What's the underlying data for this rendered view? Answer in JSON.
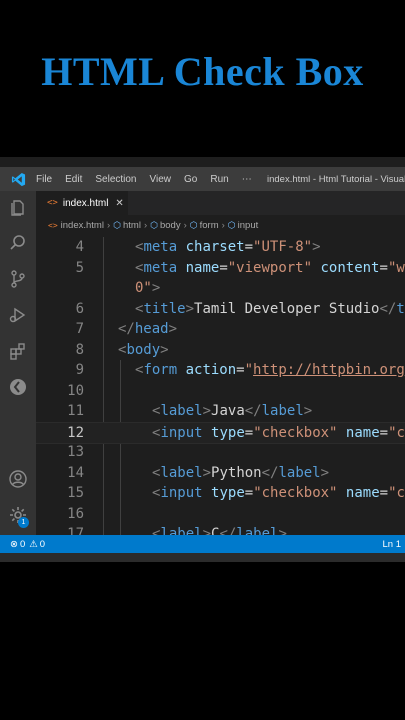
{
  "banner": {
    "title": "HTML Check Box"
  },
  "titlebar": {
    "menu": [
      "File",
      "Edit",
      "Selection",
      "View",
      "Go",
      "Run",
      "⋯"
    ],
    "window_title": "index.html - Html Tutorial - Visual"
  },
  "tab": {
    "label": "index.html",
    "close": "✕"
  },
  "breadcrumb": [
    "index.html",
    "html",
    "body",
    "form",
    "input"
  ],
  "editor": {
    "current_line": 12,
    "lines": [
      {
        "n": "4",
        "indent": 1,
        "tokens": [
          [
            "p",
            "<"
          ],
          [
            "t",
            "meta"
          ],
          [
            "w",
            " "
          ],
          [
            "a",
            "charset"
          ],
          [
            "w",
            "="
          ],
          [
            "s",
            "\"UTF-8\""
          ],
          [
            "p",
            ">"
          ]
        ]
      },
      {
        "n": "5",
        "indent": 1,
        "tokens": [
          [
            "p",
            "<"
          ],
          [
            "t",
            "meta"
          ],
          [
            "w",
            " "
          ],
          [
            "a",
            "name"
          ],
          [
            "w",
            "="
          ],
          [
            "s",
            "\"viewport\""
          ],
          [
            "w",
            " "
          ],
          [
            "a",
            "content"
          ],
          [
            "w",
            "="
          ],
          [
            "s",
            "\"wi"
          ]
        ]
      },
      {
        "n": "",
        "indent": 1,
        "tokens": [
          [
            "s",
            "0\""
          ],
          [
            "p",
            ">"
          ]
        ]
      },
      {
        "n": "6",
        "indent": 1,
        "tokens": [
          [
            "p",
            "<"
          ],
          [
            "t",
            "title"
          ],
          [
            "p",
            ">"
          ],
          [
            "w",
            "Tamil Developer Studio"
          ],
          [
            "p",
            "</"
          ],
          [
            "t",
            "ti"
          ]
        ]
      },
      {
        "n": "7",
        "indent": 0,
        "tokens": [
          [
            "p",
            "</"
          ],
          [
            "t",
            "head"
          ],
          [
            "p",
            ">"
          ]
        ]
      },
      {
        "n": "8",
        "indent": 0,
        "tokens": [
          [
            "p",
            "<"
          ],
          [
            "t",
            "body"
          ],
          [
            "p",
            ">"
          ]
        ]
      },
      {
        "n": "9",
        "indent": 1,
        "tokens": [
          [
            "p",
            "<"
          ],
          [
            "t",
            "form"
          ],
          [
            "w",
            " "
          ],
          [
            "a",
            "action"
          ],
          [
            "w",
            "="
          ],
          [
            "s",
            "\""
          ],
          [
            "u",
            "http://httpbin.org"
          ]
        ]
      },
      {
        "n": "10",
        "indent": 2,
        "tokens": []
      },
      {
        "n": "11",
        "indent": 2,
        "tokens": [
          [
            "p",
            "<"
          ],
          [
            "t",
            "label"
          ],
          [
            "p",
            ">"
          ],
          [
            "w",
            "Java"
          ],
          [
            "p",
            "</"
          ],
          [
            "t",
            "label"
          ],
          [
            "p",
            ">"
          ]
        ]
      },
      {
        "n": "12",
        "indent": 2,
        "tokens": [
          [
            "p",
            "<"
          ],
          [
            "t",
            "input"
          ],
          [
            "w",
            " "
          ],
          [
            "a",
            "type"
          ],
          [
            "w",
            "="
          ],
          [
            "s",
            "\"checkbox\""
          ],
          [
            "w",
            " "
          ],
          [
            "a",
            "name"
          ],
          [
            "w",
            "="
          ],
          [
            "s",
            "\"ch"
          ]
        ]
      },
      {
        "n": "13",
        "indent": 2,
        "tokens": []
      },
      {
        "n": "14",
        "indent": 2,
        "tokens": [
          [
            "p",
            "<"
          ],
          [
            "t",
            "label"
          ],
          [
            "p",
            ">"
          ],
          [
            "w",
            "Python"
          ],
          [
            "p",
            "</"
          ],
          [
            "t",
            "label"
          ],
          [
            "p",
            ">"
          ]
        ]
      },
      {
        "n": "15",
        "indent": 2,
        "tokens": [
          [
            "p",
            "<"
          ],
          [
            "t",
            "input"
          ],
          [
            "w",
            " "
          ],
          [
            "a",
            "type"
          ],
          [
            "w",
            "="
          ],
          [
            "s",
            "\"checkbox\""
          ],
          [
            "w",
            " "
          ],
          [
            "a",
            "name"
          ],
          [
            "w",
            "="
          ],
          [
            "s",
            "\"ch"
          ]
        ]
      },
      {
        "n": "16",
        "indent": 2,
        "tokens": []
      },
      {
        "n": "17",
        "indent": 2,
        "tokens": [
          [
            "p",
            "<"
          ],
          [
            "t",
            "label"
          ],
          [
            "p",
            ">"
          ],
          [
            "w",
            "C"
          ],
          [
            "p",
            "</"
          ],
          [
            "t",
            "label"
          ],
          [
            "p",
            ">"
          ]
        ]
      }
    ]
  },
  "statusbar": {
    "errors": "0",
    "warnings": "0",
    "position": "Ln 1"
  },
  "activity": {
    "badge": "1"
  },
  "icons": [
    "vscode-logo-icon",
    "explorer-icon",
    "search-icon",
    "source-control-icon",
    "run-debug-icon",
    "extensions-icon",
    "remote-icon",
    "account-icon",
    "settings-gear-icon"
  ],
  "colors": {
    "accent": "#007acc",
    "banner": "#1a86d6",
    "tag": "#569cd6",
    "attr": "#9cdcfe",
    "string": "#ce9178"
  }
}
